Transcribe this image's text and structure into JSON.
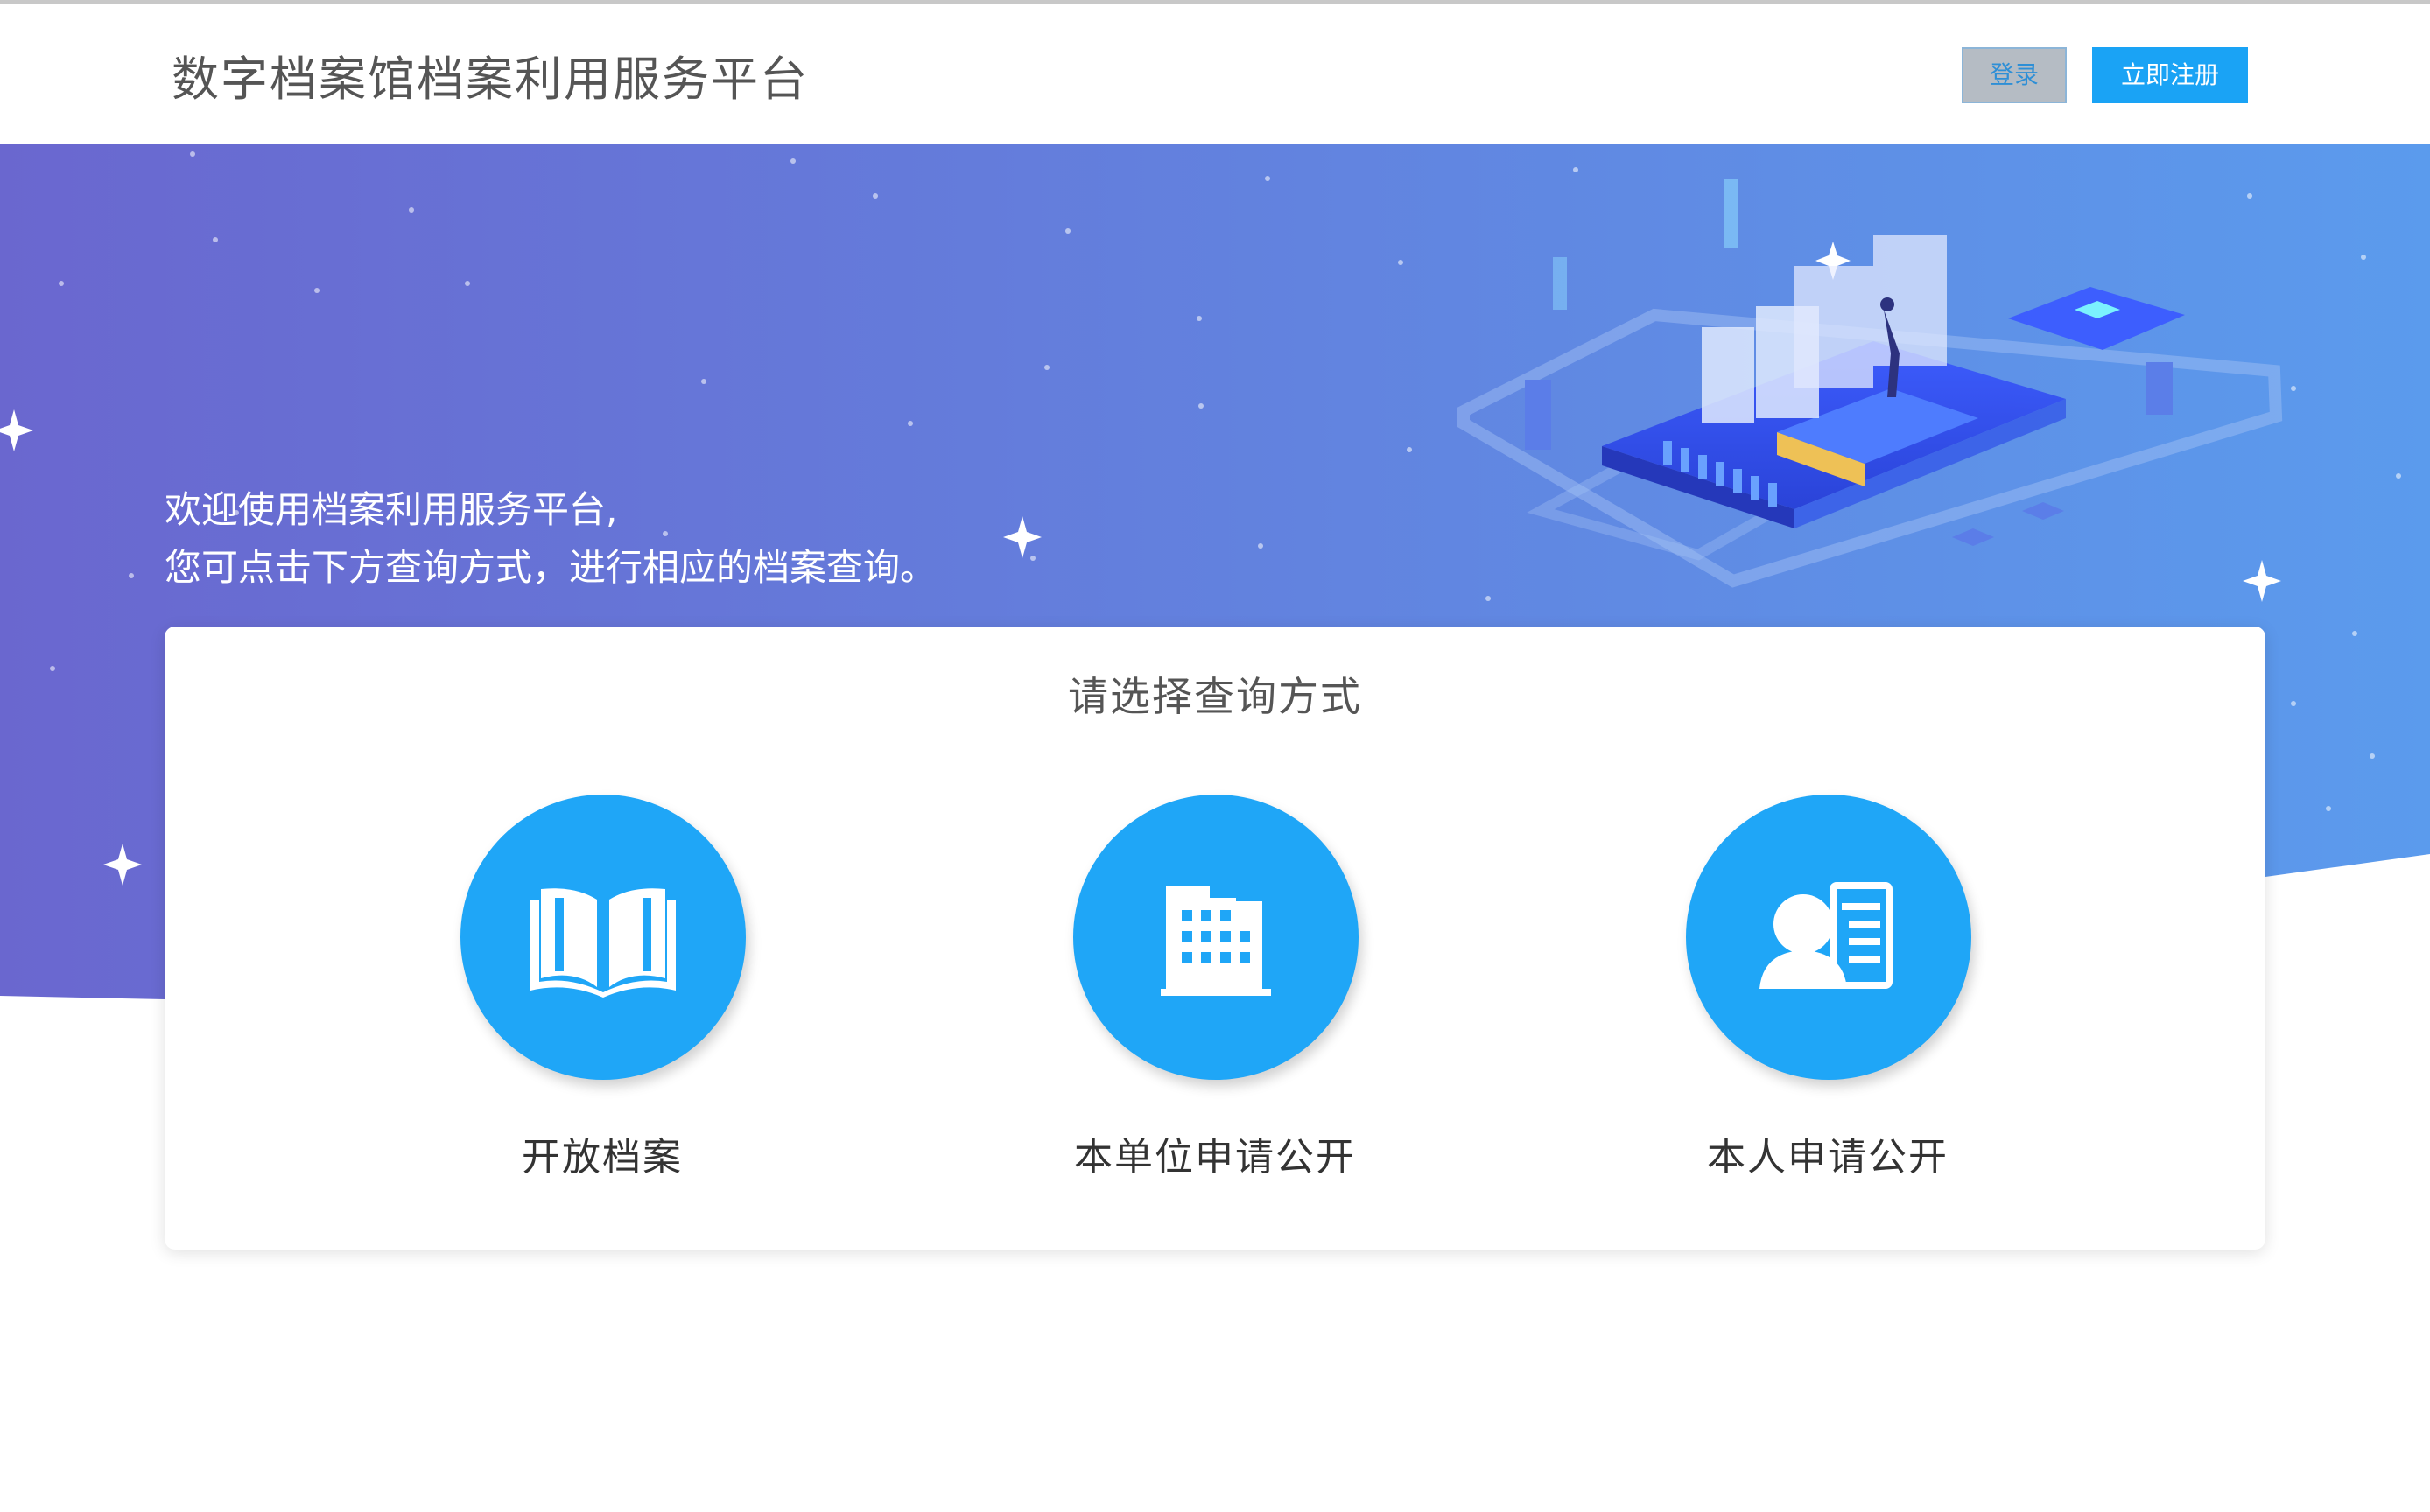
{
  "header": {
    "title": "数字档案馆档案利用服务平台",
    "login_label": "登录",
    "register_label": "立即注册"
  },
  "hero": {
    "welcome_line1": "欢迎使用档案利用服务平台,",
    "welcome_line2": "您可点击下方查询方式，进行相应的档案查询。"
  },
  "query": {
    "title": "请选择查询方式",
    "options": [
      {
        "label": "开放档案",
        "icon": "open-book-icon"
      },
      {
        "label": "本单位申请公开",
        "icon": "building-icon"
      },
      {
        "label": "本人申请公开",
        "icon": "person-card-icon"
      }
    ]
  },
  "colors": {
    "accent": "#1fa6f7",
    "hero_start": "#6a67cf",
    "hero_end": "#5b9bed"
  }
}
